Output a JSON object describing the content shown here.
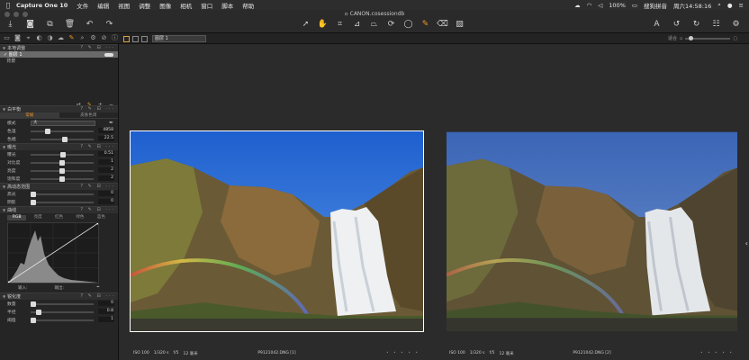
{
  "menubar": {
    "apple_icon": "apple-icon",
    "app_name": "Capture One 10",
    "items": [
      "文件",
      "编辑",
      "视图",
      "调整",
      "图像",
      "相机",
      "窗口",
      "脚本",
      "帮助"
    ],
    "battery": "100%",
    "input_method": "搜狗拼音",
    "clock": "周六14:58:16"
  },
  "window": {
    "title": "CANON.cosessiondb"
  },
  "toolbar": {
    "left_icons": [
      "import-icon",
      "camera-icon",
      "copy-icon",
      "delete-icon",
      "undo-icon",
      "redo-icon"
    ],
    "center_icons": [
      "select-icon",
      "pan-icon",
      "crop-icon",
      "straighten-icon",
      "keystone-icon",
      "rotate-icon",
      "spot-icon",
      "brush-icon",
      "eraser-icon",
      "gradient-icon"
    ],
    "right_icons": [
      "text-icon",
      "rotate-left-icon",
      "rotate-right-icon",
      "checklist-icon",
      "settings-icon"
    ]
  },
  "subbar": {
    "variant_select": "图层 1",
    "zoom_label": "适合"
  },
  "left_panel": {
    "local_adjust": {
      "title": "本地调整",
      "layers": [
        {
          "name": "图层 1",
          "selected": true
        },
        {
          "name": "背景",
          "selected": false
        }
      ]
    },
    "white_balance": {
      "title": "白平衡",
      "tabs": [
        "常规",
        "皮肤色调"
      ],
      "mode_label": "模式",
      "mode_value": "大",
      "rows": [
        {
          "label": "色温",
          "value": "4858",
          "pos": 0.25
        },
        {
          "label": "色相",
          "value": "22.5",
          "pos": 0.55
        }
      ]
    },
    "exposure": {
      "title": "曝光",
      "rows": [
        {
          "label": "曝光",
          "value": "0.51",
          "pos": 0.52
        },
        {
          "label": "对比度",
          "value": "1",
          "pos": 0.5
        },
        {
          "label": "亮度",
          "value": "2",
          "pos": 0.5
        },
        {
          "label": "饱和度",
          "value": "2",
          "pos": 0.5
        }
      ]
    },
    "hdr": {
      "title": "高动态范围",
      "rows": [
        {
          "label": "高光",
          "value": "0",
          "pos": 0.0
        },
        {
          "label": "阴影",
          "value": "0",
          "pos": 0.0
        }
      ]
    },
    "curve": {
      "title": "曲线",
      "tabs": [
        "RGB",
        "亮度",
        "红色",
        "绿色",
        "蓝色"
      ],
      "input_label": "输入:",
      "output_label": "输出:"
    },
    "clarity": {
      "title": "锐化度",
      "rows": [
        {
          "label": "数量",
          "value": "0",
          "pos": 0.0
        },
        {
          "label": "半径",
          "value": "0.8",
          "pos": 0.1
        },
        {
          "label": "阈值",
          "value": "1",
          "pos": 0.0
        }
      ]
    }
  },
  "viewer": {
    "photos": [
      {
        "filename": "P9121042.DNG [1]",
        "iso": "ISO 100",
        "shutter": "1/320 s",
        "aperture": "f/5",
        "focal": "12 毫米",
        "selected": true
      },
      {
        "filename": "P9121042.DNG [2]",
        "iso": "ISO 100",
        "shutter": "1/320 s",
        "aperture": "f/5",
        "focal": "12 毫米",
        "selected": false
      }
    ],
    "rating_stars": "• • • • •"
  },
  "colors": {
    "accent": "#f0962c",
    "background": "#2b2b2b",
    "panel": "#252525"
  }
}
